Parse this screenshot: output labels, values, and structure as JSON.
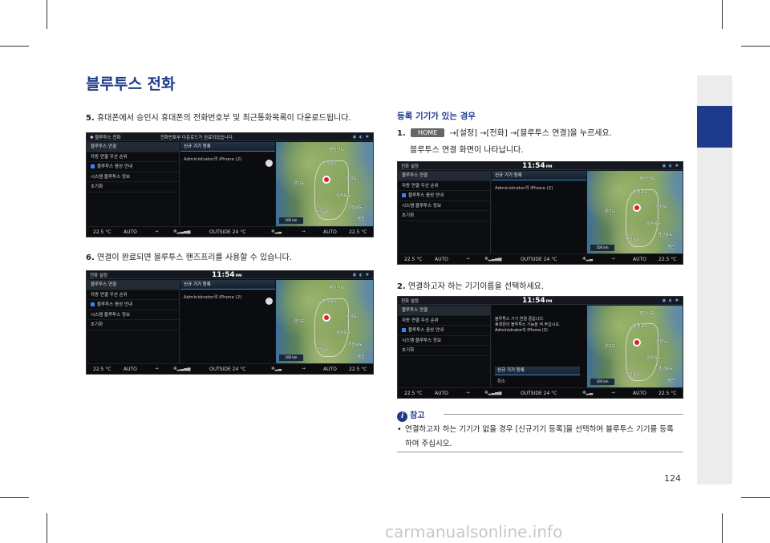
{
  "page_title": "블루투스 전화",
  "steps_left": {
    "s5_num": "5.",
    "s5_text": " 휴대폰에서 승인시 휴대폰의 전화번호부 및 최근통화목록이 다운로드됩니다.",
    "s6_num": "6.",
    "s6_text": " 연결이 완료되면 블루투스 핸즈프리를 사용할 수 있습니다."
  },
  "register_section": {
    "heading": "등록 기기가 있는 경우",
    "s1_num": "1.",
    "home_label": "HOME",
    "s1_text": "→[설정] →[전화] →[블루투스 연결]을 누르세요.",
    "s1_sub": "블루투스 연결 화면이 나타납니다.",
    "s2_num": "2.",
    "s2_text": " 연결하고자 하는 기기이름을 선택하세요."
  },
  "screens": {
    "header_title": "전화 설정",
    "header_title_bt": "블루투스 전화",
    "download_toast": "전화번호부 다운로드가 완료되었습니다.",
    "clock": "11:54",
    "clock_suffix": "PM",
    "status_icons": "▣ ◐ ✱",
    "menu": [
      "블루투스 연결",
      "자동 연결 우선 순위",
      "블루투스 음성 안내",
      "시스템 블루투스 정보",
      "초기화"
    ],
    "panel_title": "신규 기기 등록",
    "device": "Administrator의 iPhone (2)",
    "connect_msg": [
      "블루투스 기기 연결 중입니다.",
      "휴대폰의 블루투스 기능을 켜 주십시오.",
      "Administrator의 iPhone (2)"
    ],
    "cancel": "취소",
    "map_labels": [
      "평안남도",
      "황해북도",
      "강원도",
      "경기도",
      "충청북도",
      "경상북도",
      "전라북도",
      "울산"
    ],
    "scale": "100 km",
    "status_bar": {
      "left_temp": "22.5 °C",
      "left_mode": "AUTO",
      "outside": "OUTSIDE  24 °C",
      "right_mode": "AUTO",
      "right_temp": "22.5 °C"
    }
  },
  "note": {
    "tag": "참고",
    "bullet": "•",
    "text_line1": "연결하고자 하는 기기가 없을 경우 [신규기기 등록]을 선택하여 블루투스 기기를 등록",
    "text_line2": "하여 주십시오."
  },
  "page_number": "124",
  "watermark": "carmanualsonline.info"
}
